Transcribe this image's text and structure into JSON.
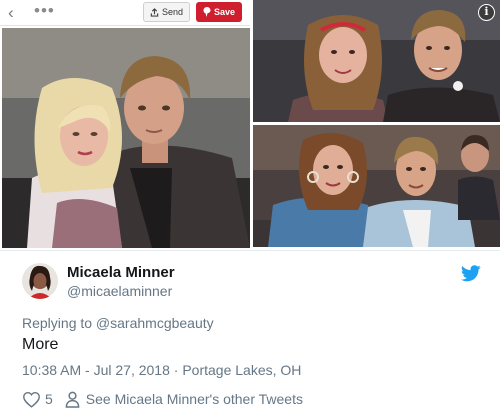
{
  "pin_toolbar": {
    "back_glyph": "‹",
    "more_glyph": "•••",
    "send_label": "Send",
    "save_label": "Save",
    "save_color": "#cf1f2e"
  },
  "info_badge": "i",
  "tweet": {
    "display_name": "Micaela Minner",
    "handle": "@micaelaminner",
    "replying_to": "Replying to @sarahmcgbeauty",
    "text": "More",
    "timestamp": "10:38 AM - Jul 27, 2018 · Portage Lakes, OH",
    "like_count": "5",
    "other_tweets_link": "See Micaela Minner's other Tweets",
    "brand_color": "#1da1f2",
    "icons": {
      "logo": "twitter-bird-icon",
      "like": "heart-icon",
      "profile": "person-icon"
    }
  }
}
